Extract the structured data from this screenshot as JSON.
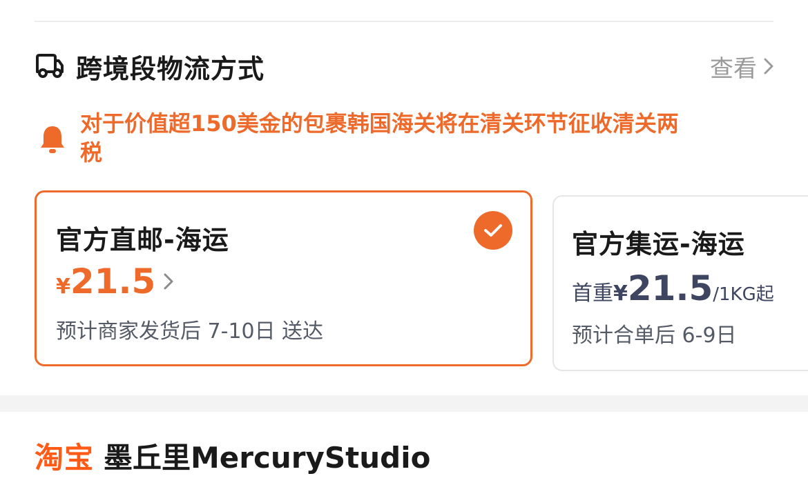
{
  "logistics": {
    "title": "跨境段物流方式",
    "view_label": "查看",
    "notice": "对于价值超150美金的包裹韩国海关将在清关环节征收清关两税"
  },
  "options": [
    {
      "name": "官方直邮-海运",
      "currency": "¥",
      "price": "21.5",
      "eta": "预计商家发货后 7-10日 送达",
      "selected": true
    },
    {
      "name": "官方集运-海运",
      "price_prefix": "首重",
      "currency": "¥",
      "price": "21.5",
      "unit": "/1KG起",
      "eta": "预计合单后 6-9日",
      "selected": false
    }
  ],
  "shop": {
    "platform_logo": "淘宝",
    "name": "墨丘里MercuryStudio"
  },
  "colors": {
    "accent": "#ee6a2b",
    "price_dark": "#3e4560",
    "muted": "#9a9a9a"
  },
  "icons": [
    "truck-icon",
    "chevron-right-icon",
    "bell-icon",
    "check-icon"
  ]
}
